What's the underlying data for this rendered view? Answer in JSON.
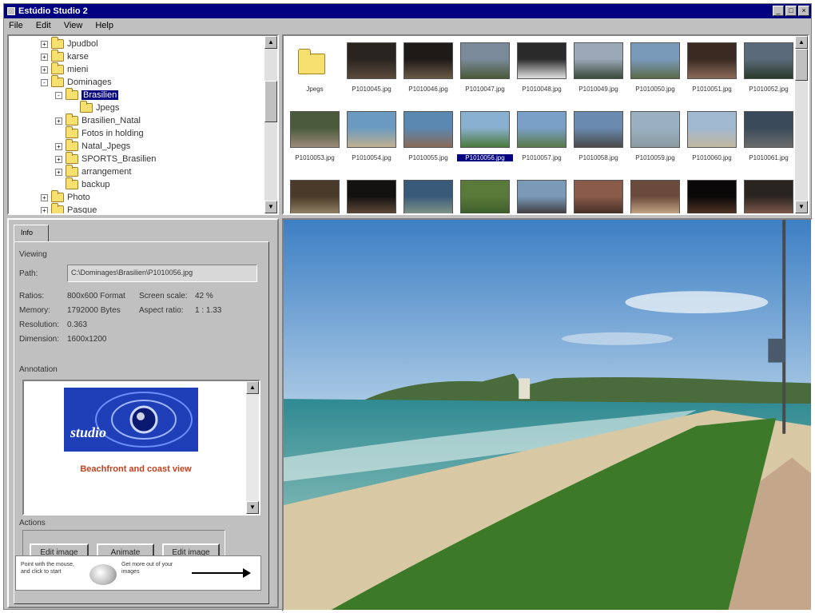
{
  "window": {
    "title": "Estúdio Studio 2",
    "controls": [
      "_",
      "□",
      "×"
    ]
  },
  "menu": [
    "File",
    "Edit",
    "View",
    "Help"
  ],
  "tree": {
    "items": [
      {
        "label": "Jpudbol",
        "indent": 0,
        "expander": "+",
        "selected": false
      },
      {
        "label": "karse",
        "indent": 0,
        "expander": "+",
        "selected": false
      },
      {
        "label": "mieni",
        "indent": 0,
        "expander": "+",
        "selected": false
      },
      {
        "label": "Dominages",
        "indent": 0,
        "expander": "-",
        "selected": false
      },
      {
        "label": "Brasilien",
        "indent": 1,
        "expander": "-",
        "selected": true
      },
      {
        "label": "Jpegs",
        "indent": 2,
        "expander": "",
        "selected": false
      },
      {
        "label": "Brasilien_Natal",
        "indent": 1,
        "expander": "+",
        "selected": false
      },
      {
        "label": "Fotos in holding",
        "indent": 1,
        "expander": "",
        "selected": false
      },
      {
        "label": "Natal_Jpegs",
        "indent": 1,
        "expander": "+",
        "selected": false
      },
      {
        "label": "SPORTS_Brasilien",
        "indent": 1,
        "expander": "+",
        "selected": false
      },
      {
        "label": "arrangement",
        "indent": 1,
        "expander": "+",
        "selected": false
      },
      {
        "label": "backup",
        "indent": 1,
        "expander": "",
        "selected": false
      },
      {
        "label": "Photo",
        "indent": 0,
        "expander": "+",
        "selected": false
      },
      {
        "label": "Pasque",
        "indent": 0,
        "expander": "+",
        "selected": false
      }
    ]
  },
  "thumbnails": {
    "folder_label": "Jpegs",
    "row1_captions": [
      "P1010045.jpg",
      "P1010046.jpg",
      "P1010047.jpg",
      "P1010048.jpg",
      "P1010049.jpg",
      "P1010050.jpg",
      "P1010051.jpg",
      "P1010052.jpg"
    ],
    "row2_captions": [
      "P1010053.jpg",
      "P1010054.jpg",
      "P1010055.jpg",
      "P1010056.jpg",
      "P1010057.jpg",
      "P1010058.jpg",
      "P1010059.jpg",
      "P1010060.jpg",
      "P1010061.jpg"
    ],
    "selected_caption": "P1010056.jpg"
  },
  "info": {
    "tab_label": "Info",
    "group_label": "Viewing",
    "path_label": "Path:",
    "path_value": "C:\\Dominages\\Brasilien\\P1010056.jpg",
    "fields": [
      {
        "label": "Ratios:",
        "value": "800x600 Format"
      },
      {
        "label": "Memory:",
        "value": "1792000 Bytes"
      },
      {
        "label": "Resolution:",
        "value": "0.363"
      },
      {
        "label": "Dimension:",
        "value": "1600x1200"
      }
    ],
    "fields_right": [
      {
        "label": "Screen scale:",
        "value": "42 %"
      },
      {
        "label": "Aspect ratio:",
        "value": "1 : 1.33"
      }
    ],
    "annotation_label": "Annotation",
    "annotation_text": "Beachfront and coast view",
    "logo_text": "studio",
    "actions_label": "Actions",
    "buttons": [
      "Edit image",
      "Animate",
      "Edit image"
    ],
    "banner_left": "Point with the mouse, and click to start",
    "banner_right": "Get more out of your images"
  },
  "colors": {
    "titlebar": "#000080",
    "face": "#c0c0c0",
    "selection": "#000080"
  }
}
